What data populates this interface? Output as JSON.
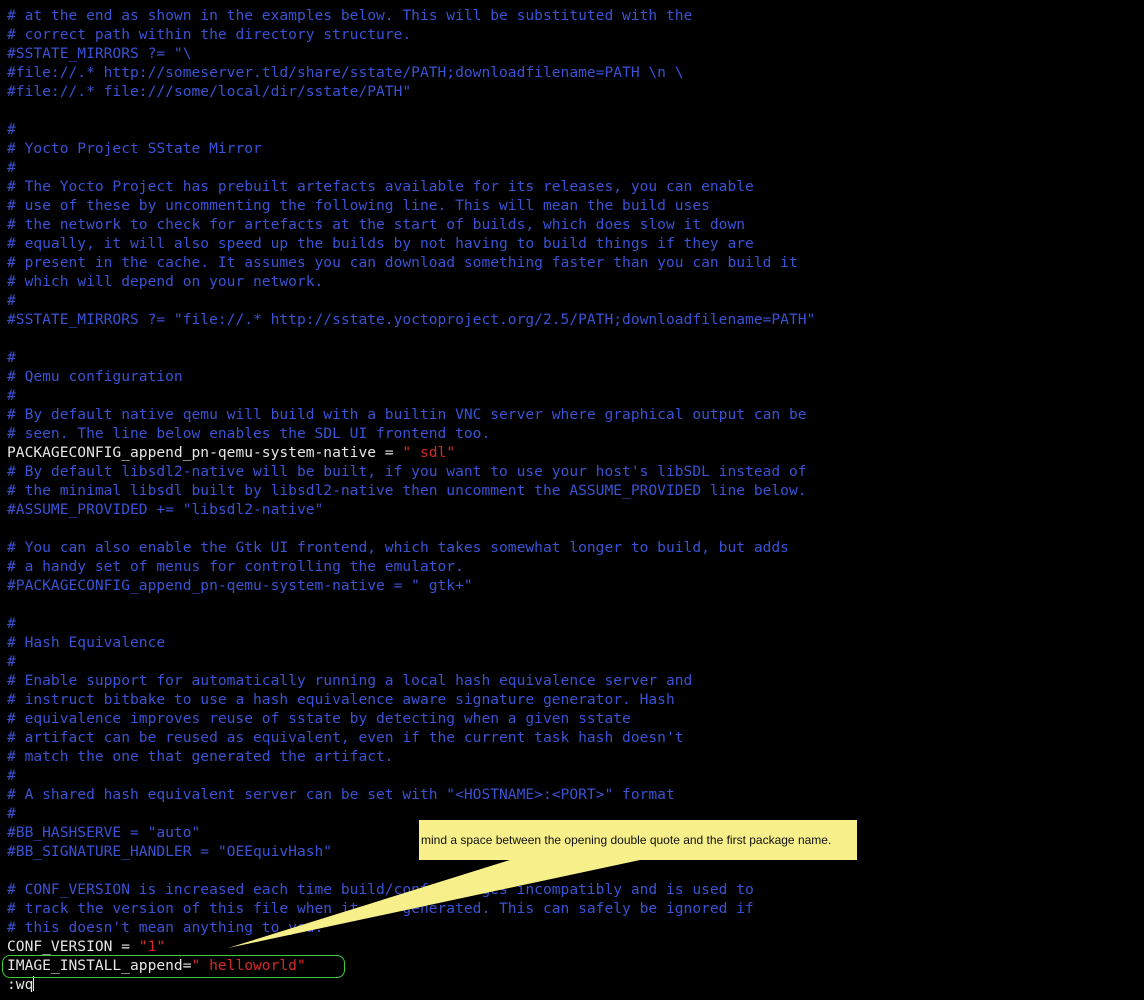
{
  "lines": [
    [
      [
        "c",
        "# at the end as shown in the examples below. This will be substituted with the"
      ]
    ],
    [
      [
        "c",
        "# correct path within the directory structure."
      ]
    ],
    [
      [
        "c",
        "#SSTATE_MIRRORS ?= \"\\"
      ]
    ],
    [
      [
        "c",
        "#file://.* http://someserver.tld/share/sstate/PATH;downloadfilename=PATH \\n \\"
      ]
    ],
    [
      [
        "c",
        "#file://.* file:///some/local/dir/sstate/PATH\""
      ]
    ],
    [],
    [
      [
        "c",
        "#"
      ]
    ],
    [
      [
        "c",
        "# Yocto Project SState Mirror"
      ]
    ],
    [
      [
        "c",
        "#"
      ]
    ],
    [
      [
        "c",
        "# The Yocto Project has prebuilt artefacts available for its releases, you can enable"
      ]
    ],
    [
      [
        "c",
        "# use of these by uncommenting the following line. This will mean the build uses"
      ]
    ],
    [
      [
        "c",
        "# the network to check for artefacts at the start of builds, which does slow it down"
      ]
    ],
    [
      [
        "c",
        "# equally, it will also speed up the builds by not having to build things if they are"
      ]
    ],
    [
      [
        "c",
        "# present in the cache. It assumes you can download something faster than you can build it"
      ]
    ],
    [
      [
        "c",
        "# which will depend on your network."
      ]
    ],
    [
      [
        "c",
        "#"
      ]
    ],
    [
      [
        "c",
        "#SSTATE_MIRRORS ?= \"file://.* http://sstate.yoctoproject.org/2.5/PATH;downloadfilename=PATH\""
      ]
    ],
    [],
    [
      [
        "c",
        "#"
      ]
    ],
    [
      [
        "c",
        "# Qemu configuration"
      ]
    ],
    [
      [
        "c",
        "#"
      ]
    ],
    [
      [
        "c",
        "# By default native qemu will build with a builtin VNC server where graphical output can be"
      ]
    ],
    [
      [
        "c",
        "# seen. The line below enables the SDL UI frontend too."
      ]
    ],
    [
      [
        "n",
        "PACKAGECONFIG_append_pn-qemu-system-native = "
      ],
      [
        "s",
        "\" sdl\""
      ]
    ],
    [
      [
        "c",
        "# By default libsdl2-native will be built, if you want to use your host's libSDL instead of"
      ]
    ],
    [
      [
        "c",
        "# the minimal libsdl built by libsdl2-native then uncomment the ASSUME_PROVIDED line below."
      ]
    ],
    [
      [
        "c",
        "#ASSUME_PROVIDED += \"libsdl2-native\""
      ]
    ],
    [],
    [
      [
        "c",
        "# You can also enable the Gtk UI frontend, which takes somewhat longer to build, but adds"
      ]
    ],
    [
      [
        "c",
        "# a handy set of menus for controlling the emulator."
      ]
    ],
    [
      [
        "c",
        "#PACKAGECONFIG_append_pn-qemu-system-native = \" gtk+\""
      ]
    ],
    [],
    [
      [
        "c",
        "#"
      ]
    ],
    [
      [
        "c",
        "# Hash Equivalence"
      ]
    ],
    [
      [
        "c",
        "#"
      ]
    ],
    [
      [
        "c",
        "# Enable support for automatically running a local hash equivalence server and"
      ]
    ],
    [
      [
        "c",
        "# instruct bitbake to use a hash equivalence aware signature generator. Hash"
      ]
    ],
    [
      [
        "c",
        "# equivalence improves reuse of sstate by detecting when a given sstate"
      ]
    ],
    [
      [
        "c",
        "# artifact can be reused as equivalent, even if the current task hash doesn't"
      ]
    ],
    [
      [
        "c",
        "# match the one that generated the artifact."
      ]
    ],
    [
      [
        "c",
        "#"
      ]
    ],
    [
      [
        "c",
        "# A shared hash equivalent server can be set with \"<HOSTNAME>:<PORT>\" format"
      ]
    ],
    [
      [
        "c",
        "#"
      ]
    ],
    [
      [
        "c",
        "#BB_HASHSERVE = \"auto\""
      ]
    ],
    [
      [
        "c",
        "#BB_SIGNATURE_HANDLER = \"OEEquivHash\""
      ]
    ],
    [],
    [
      [
        "c",
        "# CONF_VERSION is increased each time build/conf/ changes incompatibly and is used to"
      ]
    ],
    [
      [
        "c",
        "# track the version of this file when it was generated. This can safely be ignored if"
      ]
    ],
    [
      [
        "c",
        "# this doesn't mean anything to you."
      ]
    ],
    [
      [
        "n",
        "CONF_VERSION = "
      ],
      [
        "s",
        "\"1\""
      ]
    ],
    [
      [
        "n",
        "IMAGE_INSTALL_append="
      ],
      [
        "s",
        "\" helloworld\""
      ]
    ]
  ],
  "command_line": ":wq",
  "annotation": {
    "text": "mind a space between the opening double quote and the first package name."
  },
  "colors": {
    "comment": "#3a52d4",
    "normal": "#e6e6e6",
    "string": "#d22b2b",
    "highlight_border": "#3ccf3c",
    "callout_fill": "#f7ef8a"
  }
}
